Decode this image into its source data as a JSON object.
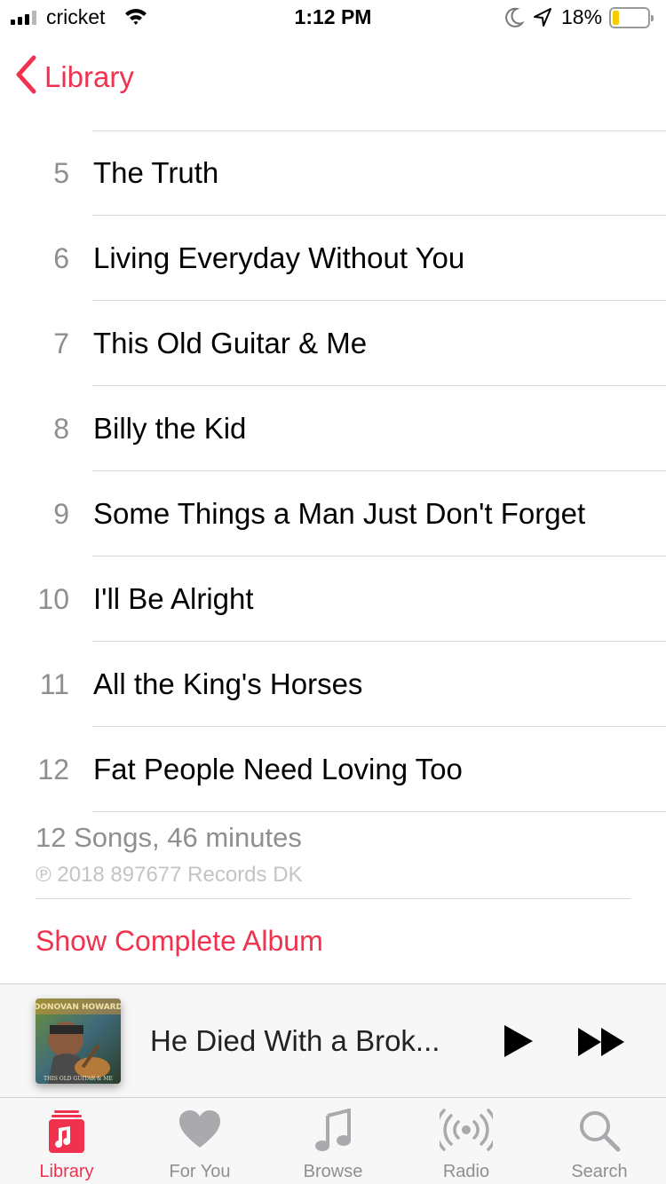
{
  "status_bar": {
    "carrier": "cricket",
    "time": "1:12 PM",
    "battery_percent": "18%",
    "battery_level": 0.18,
    "battery_color": "#f7cc00"
  },
  "nav": {
    "back_label": "Library",
    "back_icon": "chevron-left-icon"
  },
  "tracks": [
    {
      "number": "5",
      "title": "The Truth"
    },
    {
      "number": "6",
      "title": "Living Everyday Without You"
    },
    {
      "number": "7",
      "title": "This Old Guitar & Me"
    },
    {
      "number": "8",
      "title": "Billy the Kid"
    },
    {
      "number": "9",
      "title": "Some Things a Man Just Don't Forget"
    },
    {
      "number": "10",
      "title": "I'll Be Alright"
    },
    {
      "number": "11",
      "title": "All the King's Horses"
    },
    {
      "number": "12",
      "title": "Fat People Need Loving Too"
    }
  ],
  "album_footer": {
    "summary": "12 Songs, 46 minutes",
    "copyright": "℗ 2018 897677 Records DK",
    "show_complete_album": "Show Complete Album"
  },
  "mini_player": {
    "now_playing_title": "He Died With a Brok...",
    "artwork_text": "DONOVAN HOWARD",
    "artwork_subtext": "THIS OLD GUITAR & ME",
    "play_icon": "play-icon",
    "forward_icon": "fast-forward-icon"
  },
  "tab_bar": {
    "tabs": [
      {
        "label": "Library",
        "icon": "library-icon",
        "active": true
      },
      {
        "label": "For You",
        "icon": "heart-icon",
        "active": false
      },
      {
        "label": "Browse",
        "icon": "music-note-icon",
        "active": false
      },
      {
        "label": "Radio",
        "icon": "radio-icon",
        "active": false
      },
      {
        "label": "Search",
        "icon": "search-icon",
        "active": false
      }
    ]
  },
  "colors": {
    "accent": "#f0324f",
    "secondary_text": "#8e8e93",
    "separator": "#d6d6d8",
    "inactive_icon": "#a9a9ae"
  }
}
